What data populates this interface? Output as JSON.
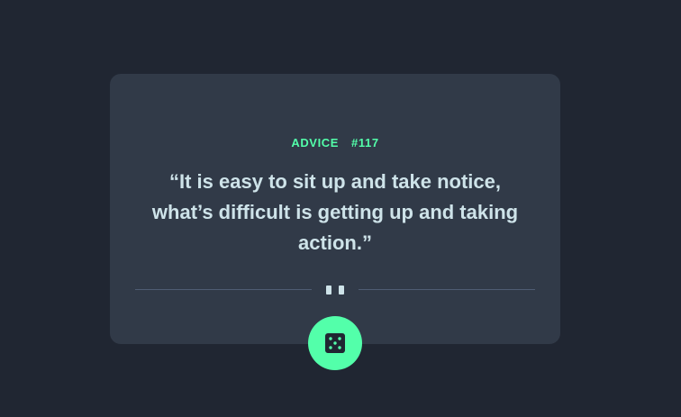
{
  "card": {
    "label": "ADVICE",
    "number": "#117",
    "quote": "“It is easy to sit up and take notice, what’s difficult is getting up and taking action.”"
  },
  "dice_button": {
    "icon": "dice-icon"
  },
  "colors": {
    "background": "#202632",
    "card": "#313a48",
    "accent": "#53ffaa",
    "text": "#cee3e9",
    "divider": "#4f5d74"
  }
}
